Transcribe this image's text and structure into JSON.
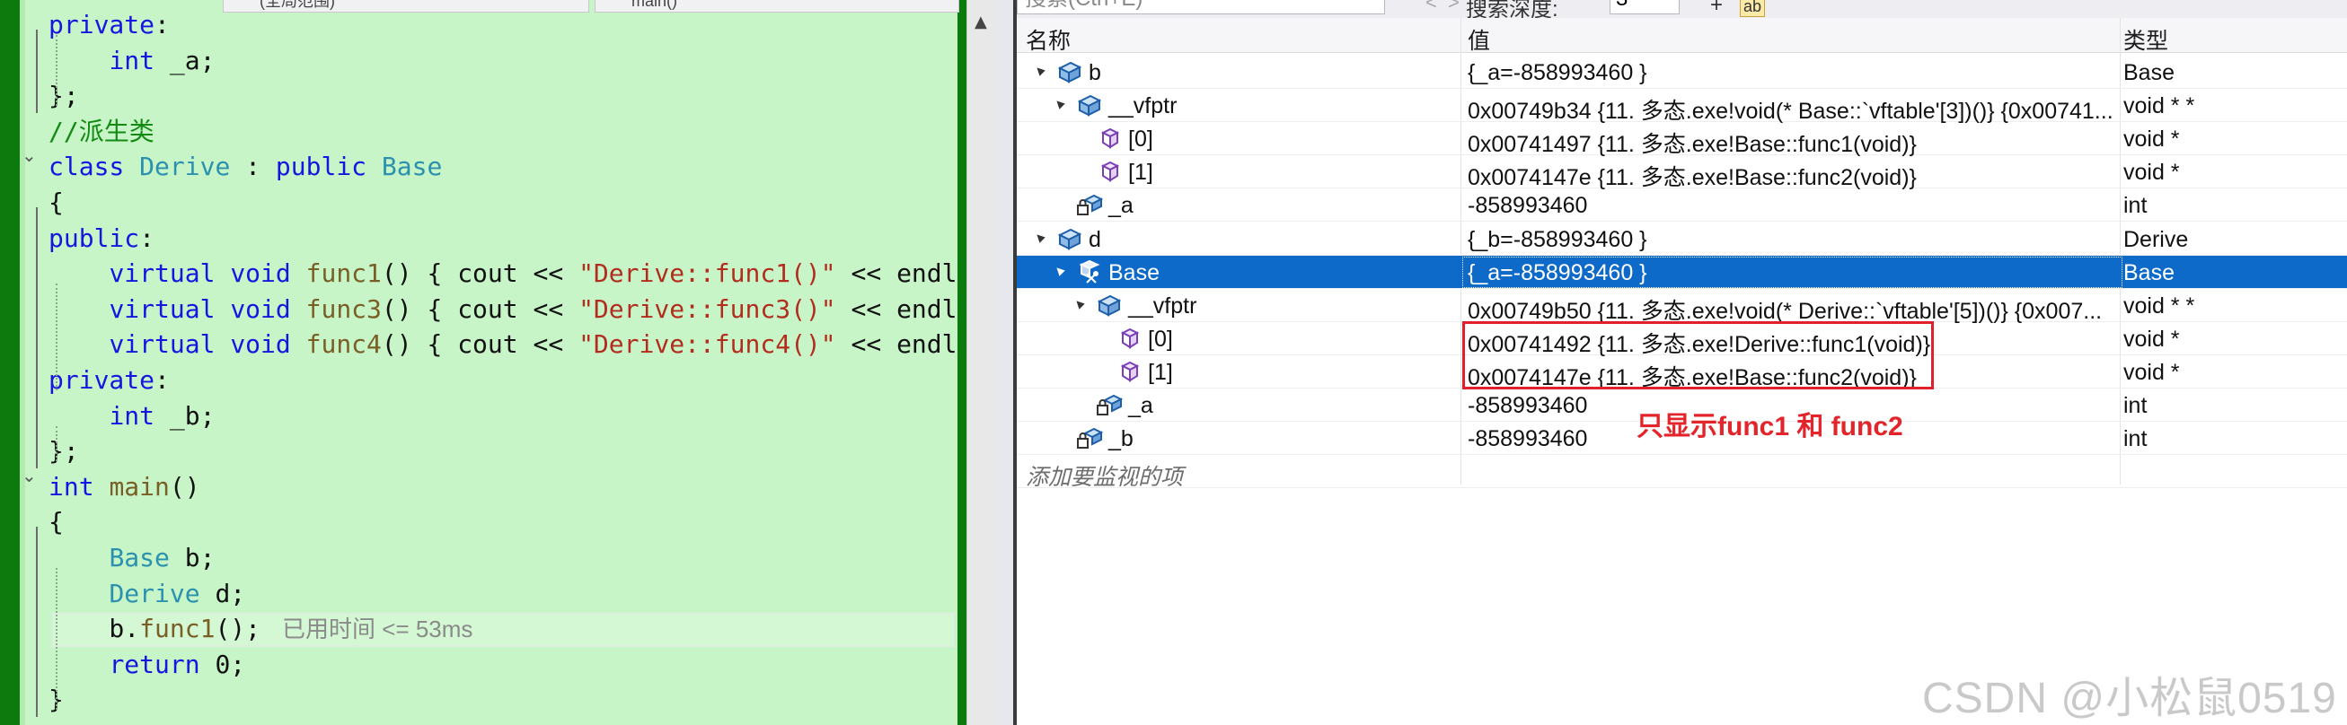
{
  "tabs": {
    "scope": "(全局范围)",
    "member": "main()"
  },
  "editor": {
    "lines": [
      {
        "id": "l1",
        "parts": [
          {
            "t": "private",
            "c": "kw"
          },
          {
            "t": ":",
            "c": ""
          }
        ]
      },
      {
        "id": "l2",
        "parts": [
          {
            "t": "    ",
            "c": ""
          },
          {
            "t": "int",
            "c": "kw"
          },
          {
            "t": " _a;",
            "c": ""
          }
        ]
      },
      {
        "id": "l3",
        "parts": [
          {
            "t": "};",
            "c": ""
          }
        ]
      },
      {
        "id": "l4",
        "parts": [
          {
            "t": "//派生类",
            "c": "cm"
          }
        ]
      },
      {
        "id": "l5",
        "parts": [
          {
            "t": "class",
            "c": "kw"
          },
          {
            "t": " ",
            "c": ""
          },
          {
            "t": "Derive",
            "c": "ty"
          },
          {
            "t": " : ",
            "c": ""
          },
          {
            "t": "public",
            "c": "kw"
          },
          {
            "t": " ",
            "c": ""
          },
          {
            "t": "Base",
            "c": "ty"
          }
        ]
      },
      {
        "id": "l6",
        "parts": [
          {
            "t": "{",
            "c": ""
          }
        ]
      },
      {
        "id": "l7",
        "parts": [
          {
            "t": "public",
            "c": "kw"
          },
          {
            "t": ":",
            "c": ""
          }
        ]
      },
      {
        "id": "l8",
        "parts": [
          {
            "t": "    ",
            "c": ""
          },
          {
            "t": "virtual",
            "c": "kw"
          },
          {
            "t": " ",
            "c": ""
          },
          {
            "t": "void",
            "c": "kw"
          },
          {
            "t": " ",
            "c": ""
          },
          {
            "t": "func1",
            "c": "fn"
          },
          {
            "t": "() { cout << ",
            "c": ""
          },
          {
            "t": "\"Derive::func1()\"",
            "c": "st"
          },
          {
            "t": " << endl; }",
            "c": ""
          }
        ]
      },
      {
        "id": "l9",
        "parts": [
          {
            "t": "    ",
            "c": ""
          },
          {
            "t": "virtual",
            "c": "kw"
          },
          {
            "t": " ",
            "c": ""
          },
          {
            "t": "void",
            "c": "kw"
          },
          {
            "t": " ",
            "c": ""
          },
          {
            "t": "func3",
            "c": "fn"
          },
          {
            "t": "() { cout << ",
            "c": ""
          },
          {
            "t": "\"Derive::func3()\"",
            "c": "st"
          },
          {
            "t": " << endl; }",
            "c": ""
          }
        ]
      },
      {
        "id": "l10",
        "parts": [
          {
            "t": "    ",
            "c": ""
          },
          {
            "t": "virtual",
            "c": "kw"
          },
          {
            "t": " ",
            "c": ""
          },
          {
            "t": "void",
            "c": "kw"
          },
          {
            "t": " ",
            "c": ""
          },
          {
            "t": "func4",
            "c": "fn"
          },
          {
            "t": "() { cout << ",
            "c": ""
          },
          {
            "t": "\"Derive::func4()\"",
            "c": "st"
          },
          {
            "t": " << endl; }",
            "c": ""
          }
        ]
      },
      {
        "id": "l11",
        "parts": [
          {
            "t": "private",
            "c": "kw"
          },
          {
            "t": ":",
            "c": ""
          }
        ]
      },
      {
        "id": "l12",
        "parts": [
          {
            "t": "    ",
            "c": ""
          },
          {
            "t": "int",
            "c": "kw"
          },
          {
            "t": " _b;",
            "c": ""
          }
        ]
      },
      {
        "id": "l13",
        "parts": [
          {
            "t": "};",
            "c": ""
          }
        ]
      },
      {
        "id": "l14",
        "parts": [
          {
            "t": "int",
            "c": "kw"
          },
          {
            "t": " ",
            "c": ""
          },
          {
            "t": "main",
            "c": "fn"
          },
          {
            "t": "()",
            "c": ""
          }
        ]
      },
      {
        "id": "l15",
        "parts": [
          {
            "t": "{",
            "c": ""
          }
        ]
      },
      {
        "id": "l16",
        "parts": [
          {
            "t": "    ",
            "c": ""
          },
          {
            "t": "Base",
            "c": "ty"
          },
          {
            "t": " b;",
            "c": ""
          }
        ]
      },
      {
        "id": "l17",
        "parts": [
          {
            "t": "    ",
            "c": ""
          },
          {
            "t": "Derive",
            "c": "ty"
          },
          {
            "t": " d;",
            "c": ""
          }
        ]
      },
      {
        "id": "l18",
        "parts": [
          {
            "t": "    b.",
            "c": ""
          },
          {
            "t": "func1",
            "c": "fn"
          },
          {
            "t": "();",
            "c": ""
          }
        ]
      },
      {
        "id": "l19",
        "parts": [
          {
            "t": "    ",
            "c": ""
          },
          {
            "t": "return",
            "c": "kw"
          },
          {
            "t": " 0;",
            "c": ""
          }
        ]
      },
      {
        "id": "l20",
        "parts": [
          {
            "t": "}",
            "c": ""
          }
        ]
      }
    ],
    "perf_tip": "已用时间 <= 53ms"
  },
  "watch": {
    "search_placeholder": "搜索(Ctrl+E)",
    "depth_label": "搜索深度:",
    "depth_value": "3",
    "columns": {
      "name": "名称",
      "value": "值",
      "type": "类型"
    },
    "rows": [
      {
        "name": "b",
        "value": "{_a=-858993460 }",
        "type": "Base",
        "expander": "▲",
        "icon": "object-icon"
      },
      {
        "name": "__vfptr",
        "value": "0x00749b34 {11. 多态.exe!void(* Base::`vftable'[3])()} {0x00741...",
        "type": "void * *",
        "expander": "▲",
        "icon": "object-icon"
      },
      {
        "name": "[0]",
        "value": "0x00741497 {11. 多态.exe!Base::func1(void)}",
        "type": "void *",
        "expander": "",
        "icon": "cube-icon"
      },
      {
        "name": "[1]",
        "value": "0x0074147e {11. 多态.exe!Base::func2(void)}",
        "type": "void *",
        "expander": "",
        "icon": "cube-icon"
      },
      {
        "name": "_a",
        "value": "-858993460",
        "type": "int",
        "expander": "",
        "icon": "private-field-icon"
      },
      {
        "name": "d",
        "value": "{_b=-858993460 }",
        "type": "Derive",
        "expander": "▲",
        "icon": "object-icon"
      },
      {
        "name": "Base",
        "value": "{_a=-858993460 }",
        "type": "Base",
        "expander": "▲",
        "icon": "base-class-icon",
        "selected": true
      },
      {
        "name": "__vfptr",
        "value": "0x00749b50 {11. 多态.exe!void(* Derive::`vftable'[5])()} {0x007...",
        "type": "void * *",
        "expander": "▲",
        "icon": "object-icon"
      },
      {
        "name": "[0]",
        "value": "0x00741492 {11. 多态.exe!Derive::func1(void)}",
        "type": "void *",
        "expander": "",
        "icon": "cube-icon"
      },
      {
        "name": "[1]",
        "value": "0x0074147e {11. 多态.exe!Base::func2(void)}",
        "type": "void *",
        "expander": "",
        "icon": "cube-icon"
      },
      {
        "name": "_a",
        "value": "-858993460",
        "type": "int",
        "expander": "",
        "icon": "private-field-icon"
      },
      {
        "name": "_b",
        "value": "-858993460",
        "type": "int",
        "expander": "",
        "icon": "private-field-icon"
      },
      {
        "name": "添加要监视的项",
        "value": "",
        "type": "",
        "expander": "",
        "icon": "",
        "add": true
      }
    ],
    "annotation": "只显示func1 和 func2"
  },
  "watermark": "CSDN @小松鼠0519",
  "colors": {
    "editor_bg": "#c7f5c7",
    "selection": "#0e6ac8",
    "annotation": "#e3252b"
  }
}
